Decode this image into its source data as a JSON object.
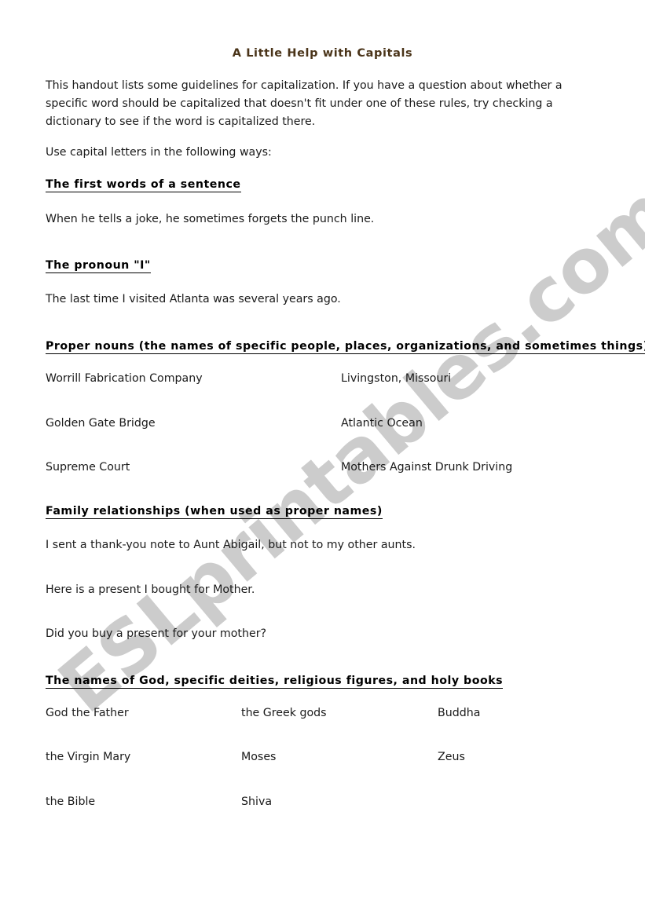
{
  "document": {
    "title": "A Little Help with Capitals",
    "title_color": "#4a3419",
    "watermark": "ESLprintables.com",
    "watermark_color": "#cccccc",
    "intro": "This handout lists some guidelines for capitalization. If you have a question about whether a specific word should be capitalized that doesn't fit under one of these rules, try checking a dictionary to see if the word is capitalized there.",
    "lead_in": "Use capital letters in the following ways:",
    "sections": [
      {
        "heading": "The first words of a sentence",
        "examples": [
          "When he tells a joke, he sometimes forgets the punch line."
        ]
      },
      {
        "heading": "The pronoun \"I\"",
        "examples": [
          "The last time I visited Atlanta was several years ago."
        ]
      },
      {
        "heading": "Proper nouns (the names of specific people, places, organizations, and sometimes things)",
        "columns": [
          [
            "Worrill Fabrication Company",
            "Golden Gate Bridge",
            "Supreme Court"
          ],
          [
            "Livingston, Missouri",
            "Atlantic Ocean",
            "Mothers Against Drunk Driving"
          ]
        ]
      },
      {
        "heading": "Family relationships (when used as proper names)",
        "examples": [
          "I sent a thank-you note to Aunt Abigail, but not to my other aunts.",
          "Here is a present I bought for Mother.",
          "Did you buy a present for your mother?"
        ]
      },
      {
        "heading": "The names of God, specific deities, religious figures, and holy books",
        "columns": [
          [
            "God the Father",
            "the Virgin Mary",
            "the Bible"
          ],
          [
            "the Greek gods",
            "Moses",
            "Shiva"
          ],
          [
            "Buddha",
            "Zeus",
            ""
          ]
        ]
      }
    ]
  }
}
